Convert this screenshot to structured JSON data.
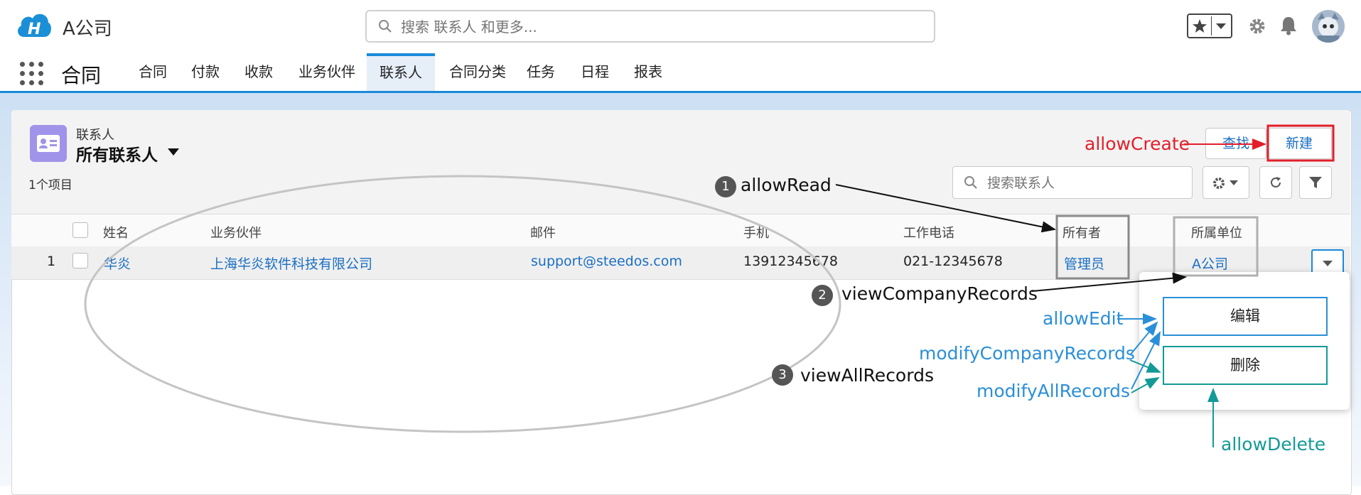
{
  "header": {
    "company": "A公司",
    "search_placeholder": "搜索 联系人 和更多..."
  },
  "nav": {
    "app_name": "合同",
    "tabs": [
      {
        "label": "合同"
      },
      {
        "label": "付款"
      },
      {
        "label": "收款"
      },
      {
        "label": "业务伙伴"
      },
      {
        "label": "联系人"
      },
      {
        "label": "合同分类"
      },
      {
        "label": "任务"
      },
      {
        "label": "日程"
      },
      {
        "label": "报表"
      }
    ],
    "active_tab": "联系人"
  },
  "list": {
    "object_label": "联系人",
    "view_name": "所有联系人",
    "item_count": "1个项目",
    "search_placeholder": "搜索联系人",
    "find_label": "查找",
    "new_label": "新建"
  },
  "table": {
    "columns": [
      "姓名",
      "业务伙伴",
      "邮件",
      "手机",
      "工作电话",
      "所有者",
      "所属单位"
    ],
    "rows": [
      {
        "index": "1",
        "name": "华炎",
        "partner": "上海华炎软件科技有限公司",
        "email": "support@steedos.com",
        "mobile": "13912345678",
        "work_phone": "021-12345678",
        "owner": "管理员",
        "company": "A公司"
      }
    ]
  },
  "row_menu": {
    "edit_label": "编辑",
    "delete_label": "删除"
  },
  "annotations": {
    "allow_create": "allowCreate",
    "allow_read": "allowRead",
    "view_company_records": "viewCompanyRecords",
    "view_all_records": "viewAllRecords",
    "allow_edit": "allowEdit",
    "modify_company_records": "modifyCompanyRecords",
    "modify_all_records": "modifyAllRecords",
    "allow_delete": "allowDelete",
    "num_1": "1",
    "num_2": "2",
    "num_3": "3"
  },
  "colors": {
    "accent": "#1a8ad8",
    "object_icon": "#a094ea",
    "link": "#1a6fc4",
    "annotation_red": "#e31e2a",
    "annotation_blue": "#2b8fd8",
    "annotation_teal": "#139a97"
  }
}
